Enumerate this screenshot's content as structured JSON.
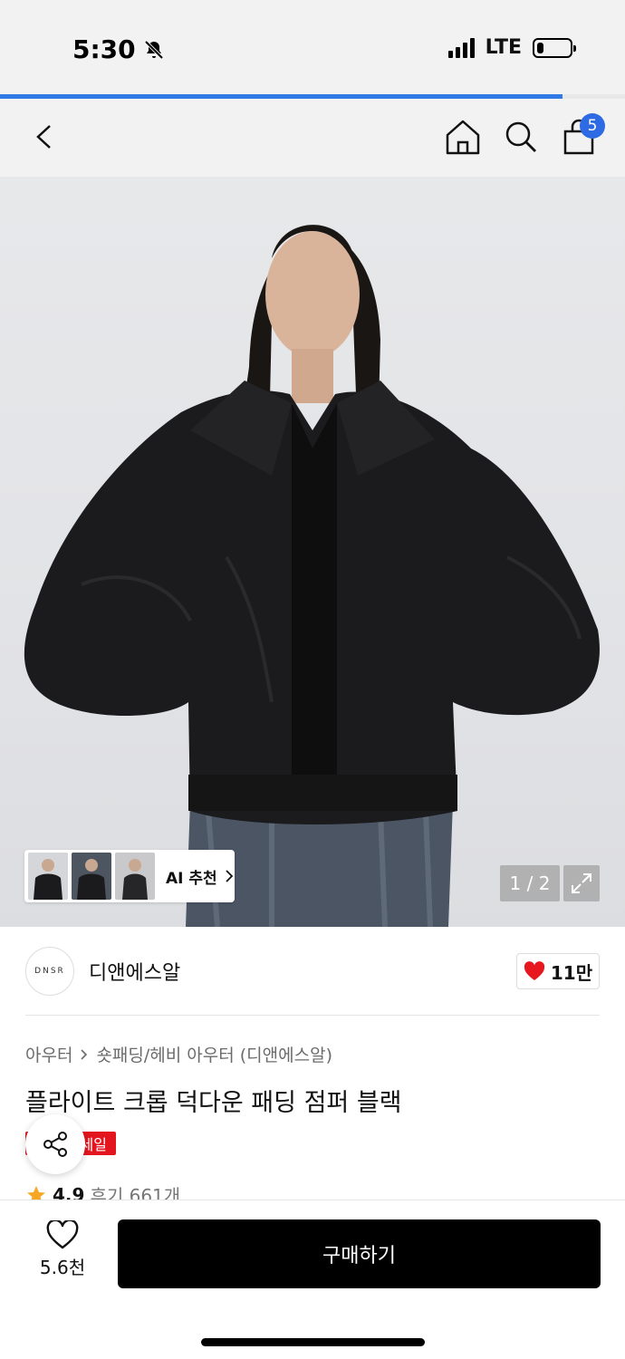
{
  "status_bar": {
    "time": "5:30",
    "network": "LTE",
    "battery_level": 0.2
  },
  "page_progress": 0.9,
  "nav": {
    "cart_count": "5"
  },
  "gallery": {
    "ai_label": "AI 추천",
    "counter": "1 / 2"
  },
  "brand": {
    "logo_text": "DNSR",
    "name": "디앤에스알",
    "likes": "11만"
  },
  "product": {
    "breadcrumb": [
      "아우터",
      "숏패딩/헤비 아우터 (디앤에스알)"
    ],
    "title": "플라이트 크롭 덕다운 패딩 점퍼 블랙",
    "sale_tag": "세일",
    "rating": "4.9",
    "reviews": "후기 661개"
  },
  "bottom_bar": {
    "wish_count": "5.6천",
    "buy_label": "구매하기"
  },
  "colors": {
    "accent_blue": "#2f7ae5",
    "sale_red": "#e3161f",
    "heart_red": "#e8161e",
    "star": "#f5a623"
  }
}
